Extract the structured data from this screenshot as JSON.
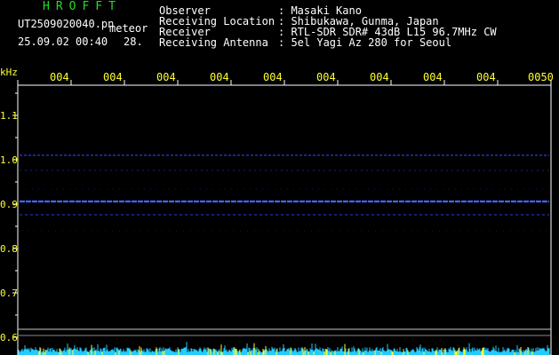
{
  "header": {
    "brand": "HROFFT",
    "filename": "UT2509020040.pn",
    "meteor_label": "meteor",
    "datetime": "25.09.02 00:40",
    "count": "28.",
    "info_labels": [
      "Observer",
      "Receiving Location",
      "Receiver",
      "Receiving Antenna"
    ],
    "info_values": [
      ": Masaki Kano",
      ": Shibukawa, Gunma, Japan",
      ": RTL-SDR SDR# 43dB L15 96.7MHz CW",
      ": 5el Yagi Az 280 for Seoul"
    ]
  },
  "axis": {
    "unit_label": "kHz",
    "y_ticks": [
      "1.1",
      "1.0",
      "0.9",
      "0.8",
      "0.7",
      "0.6"
    ],
    "x_ticks": [
      "004",
      "004",
      "004",
      "004",
      "004",
      "004",
      "004",
      "004",
      "004",
      "0050"
    ]
  },
  "colors": {
    "background": "#000000",
    "brand": "#22dd22",
    "axis_text": "#ffff33",
    "signal": "#3355ff",
    "noise": "#22ccff"
  }
}
